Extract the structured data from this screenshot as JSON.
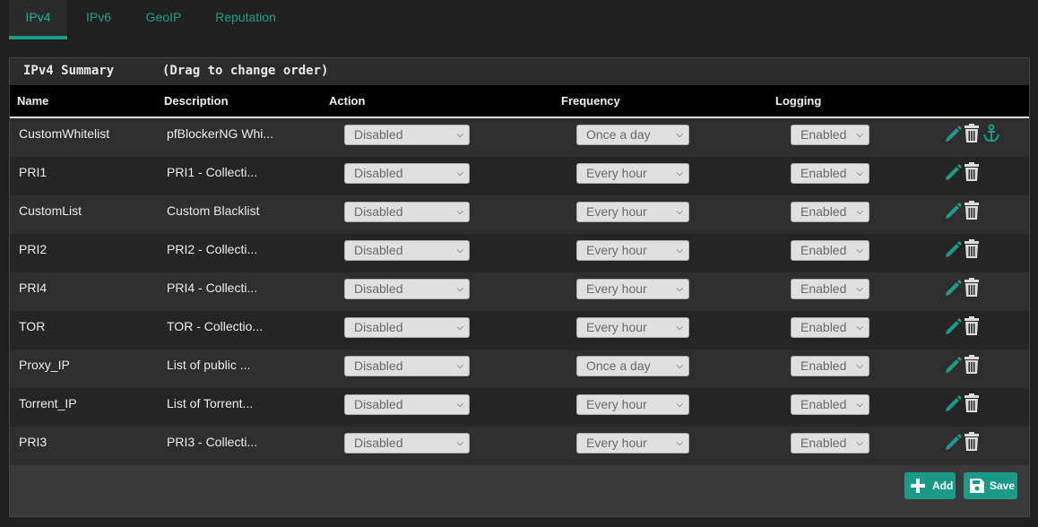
{
  "tabs": [
    {
      "label": "IPv4",
      "active": true
    },
    {
      "label": "IPv6",
      "active": false
    },
    {
      "label": "GeoIP",
      "active": false
    },
    {
      "label": "Reputation",
      "active": false
    }
  ],
  "panel": {
    "title": "IPv4 Summary",
    "subtitle": "(Drag to change order)"
  },
  "table": {
    "headers": {
      "name": "Name",
      "description": "Description",
      "action": "Action",
      "frequency": "Frequency",
      "logging": "Logging"
    },
    "rows": [
      {
        "name": "CustomWhitelist",
        "description": "pfBlockerNG Whi...",
        "action": "Disabled",
        "frequency": "Once a day",
        "logging": "Enabled",
        "anchor": true
      },
      {
        "name": "PRI1",
        "description": "PRI1 - Collecti...",
        "action": "Disabled",
        "frequency": "Every hour",
        "logging": "Enabled",
        "anchor": false
      },
      {
        "name": "CustomList",
        "description": "Custom Blacklist",
        "action": "Disabled",
        "frequency": "Every hour",
        "logging": "Enabled",
        "anchor": false
      },
      {
        "name": "PRI2",
        "description": "PRI2 - Collecti...",
        "action": "Disabled",
        "frequency": "Every hour",
        "logging": "Enabled",
        "anchor": false
      },
      {
        "name": "PRI4",
        "description": "PRI4 - Collecti...",
        "action": "Disabled",
        "frequency": "Every hour",
        "logging": "Enabled",
        "anchor": false
      },
      {
        "name": "TOR",
        "description": "TOR - Collectio...",
        "action": "Disabled",
        "frequency": "Every hour",
        "logging": "Enabled",
        "anchor": false
      },
      {
        "name": "Proxy_IP",
        "description": "List of public ...",
        "action": "Disabled",
        "frequency": "Once a day",
        "logging": "Enabled",
        "anchor": false
      },
      {
        "name": "Torrent_IP",
        "description": "List of Torrent...",
        "action": "Disabled",
        "frequency": "Every hour",
        "logging": "Enabled",
        "anchor": false
      },
      {
        "name": "PRI3",
        "description": "PRI3 - Collecti...",
        "action": "Disabled",
        "frequency": "Every hour",
        "logging": "Enabled",
        "anchor": false
      }
    ]
  },
  "buttons": {
    "add": {
      "label": "Add",
      "icon": "plus-icon"
    },
    "save": {
      "label": "Save",
      "icon": "floppy-icon"
    }
  },
  "colors": {
    "accent": "#1d9b8a",
    "background": "#202020",
    "header_bg": "#000000"
  }
}
